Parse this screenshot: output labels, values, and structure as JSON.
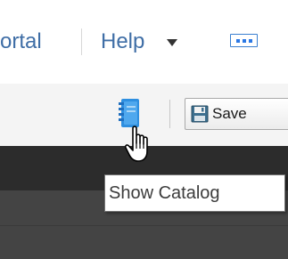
{
  "nav": {
    "portal_label": "ortal",
    "help_label": "Help"
  },
  "toolbar": {
    "save_label": "Save"
  },
  "tooltip": {
    "text": "Show Catalog"
  },
  "icons": {
    "help_caret": "caret-down-icon",
    "more": "more-dots-icon",
    "catalog": "catalog-book-icon",
    "save": "floppy-disk-icon",
    "cursor": "hand-pointer-icon"
  },
  "colors": {
    "nav_link": "#3f6ea6",
    "accent_blue": "#2b78e4",
    "toolbar_bg": "#f4f4f4",
    "dark_band": "#2c2c2c",
    "dark_lower": "#444444"
  }
}
